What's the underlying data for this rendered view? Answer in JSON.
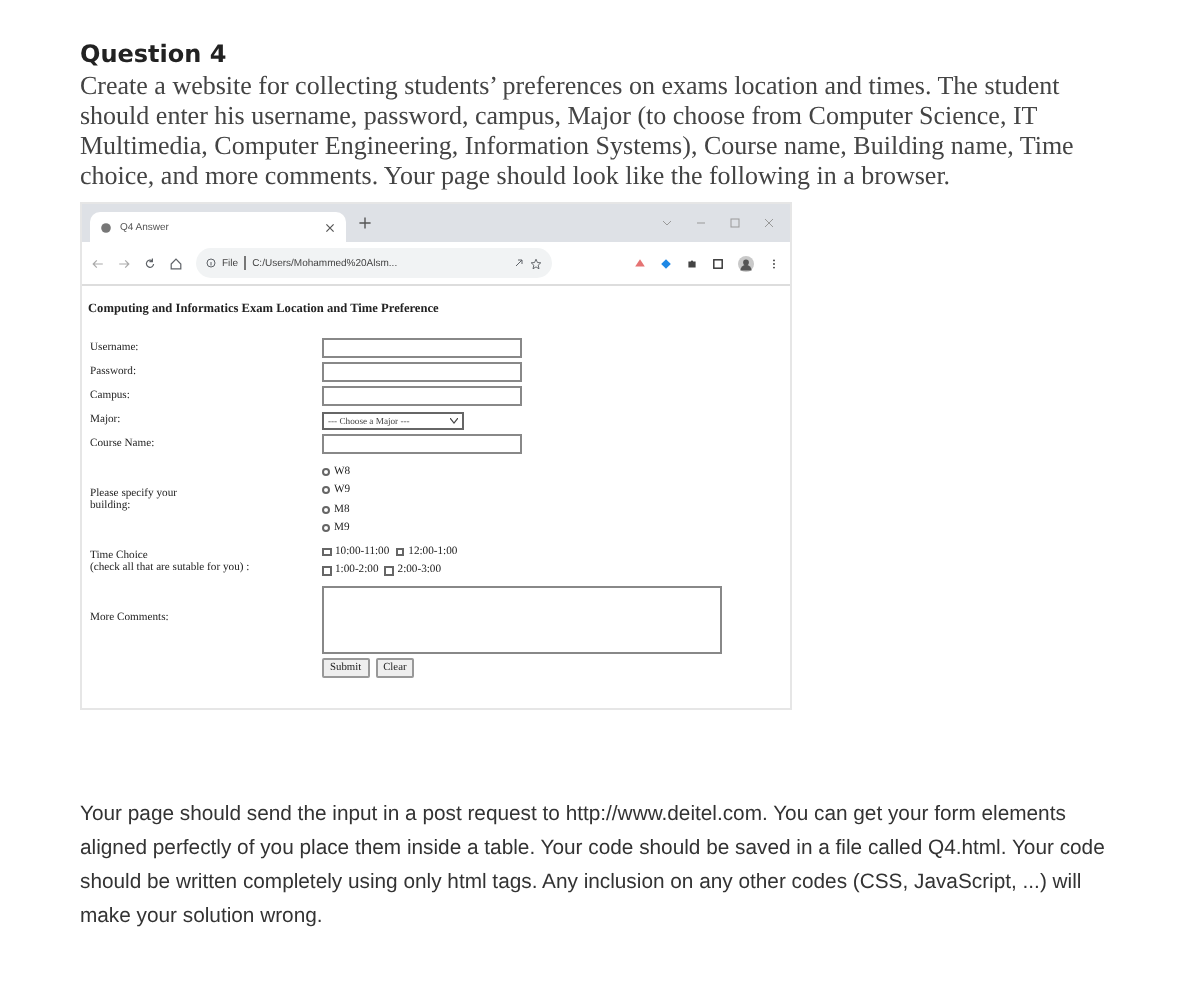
{
  "question": {
    "title": "Question 4",
    "text": "Create a website for collecting students’ preferences on exams location and times. The student should enter his username, password, campus, Major (to choose from Computer Science, IT Multimedia, Computer Engineering, Information Systems), Course name, Building name, Time choice, and more comments. Your page should look like the following in a browser."
  },
  "browser": {
    "tab": {
      "title": "Q4 Answer"
    },
    "address": {
      "scheme": "File",
      "path": "C:/Users/Mohammed%20Alsm..."
    },
    "heading": "Computing and Informatics Exam Location and Time Preference",
    "fields": [
      {
        "label": "Username:",
        "kind": "text"
      },
      {
        "label": "Password:",
        "kind": "text"
      },
      {
        "label": "Campus:",
        "kind": "text"
      },
      {
        "label": "Major:",
        "kind": "select",
        "value": "--- Choose a Major ---"
      },
      {
        "label": "Course Name:",
        "kind": "text"
      }
    ],
    "building": {
      "label": "Please specify your building:",
      "options": [
        {
          "label": "W8",
          "selected": false
        },
        {
          "label": "W9",
          "selected": false
        },
        {
          "label": "M8",
          "selected": false
        },
        {
          "label": "M9",
          "selected": false
        }
      ]
    },
    "time": {
      "label": "Time Choice",
      "hint": "(check all that are sutable for you) :",
      "options": [
        {
          "label": "10:00-11:00",
          "checked": false
        },
        {
          "label": "12:00-1:00",
          "checked": false
        },
        {
          "label": "1:00-2:00",
          "checked": false
        },
        {
          "label": "2:00-3:00",
          "checked": false
        }
      ]
    },
    "comments": {
      "label": "More Comments:"
    },
    "buttons": [
      "Submit",
      "Clear"
    ]
  },
  "footer": "Your page should send the input in a post request to http://www.deitel.com. You can get your form elements aligned perfectly of you place them inside a table. Your code should be saved in a file called Q4.html. Your code should be written completely using only html tags. Any inclusion on any other codes (CSS, JavaScript, ...) will make your solution wrong."
}
